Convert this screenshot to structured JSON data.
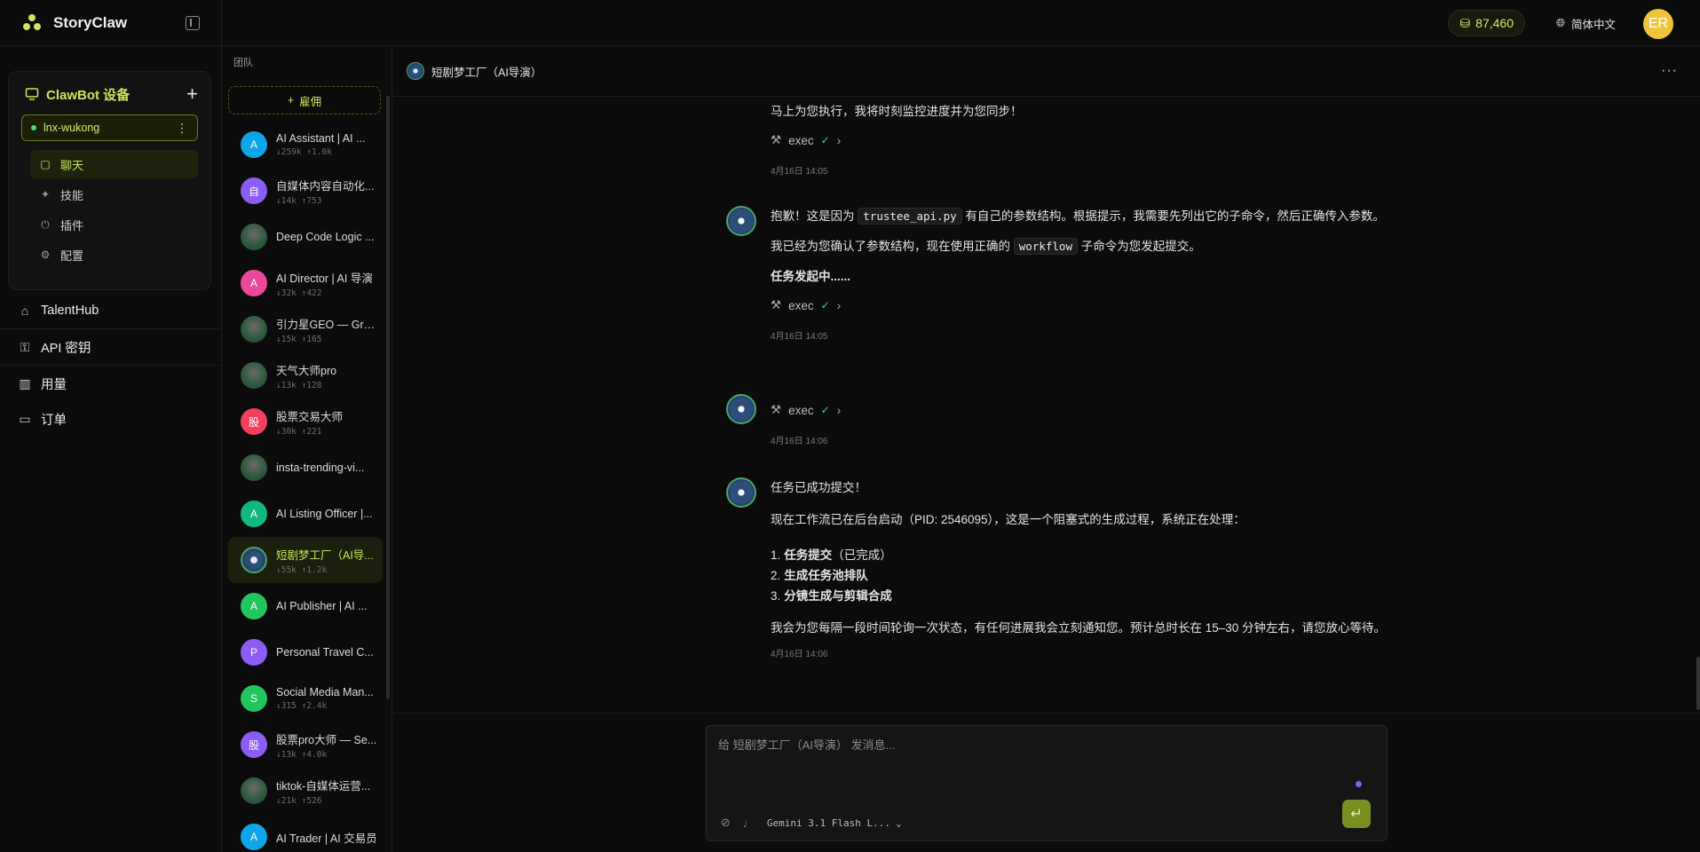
{
  "app": {
    "name": "StoryClaw"
  },
  "topbar": {
    "credits": "87,460",
    "language": "简体中文",
    "user_initials": "ER"
  },
  "device_card": {
    "title": "ClawBot 设备",
    "device_name": "lnx-wukong",
    "menu": [
      {
        "label": "聊天",
        "icon": "chat-icon",
        "active": true
      },
      {
        "label": "技能",
        "icon": "sparkle-icon",
        "active": false
      },
      {
        "label": "插件",
        "icon": "plug-icon",
        "active": false
      },
      {
        "label": "配置",
        "icon": "gear-icon",
        "active": false
      }
    ]
  },
  "nav": [
    {
      "label": "TalentHub",
      "icon": "robot-icon"
    },
    {
      "label": "API 密钥",
      "icon": "key-icon"
    },
    {
      "label": "用量",
      "icon": "bar-chart-icon"
    },
    {
      "label": "订单",
      "icon": "card-icon"
    }
  ],
  "agents_panel": {
    "title": "团队",
    "hire_label": "雇佣",
    "agents": [
      {
        "name": "AI Assistant | AI ...",
        "stats": "↓259k ↑1.0k",
        "avatar": "A",
        "color": "#0ea5e9",
        "type": "letter"
      },
      {
        "name": "自媒体内容自动化...",
        "stats": "↓14k ↑753",
        "avatar": "自",
        "color": "#8b5cf6",
        "type": "letter"
      },
      {
        "name": "Deep Code Logic ...",
        "stats": "",
        "avatar": "",
        "color": "",
        "type": "img"
      },
      {
        "name": "AI Director | AI 导演",
        "stats": "↓32k ↑422",
        "avatar": "A",
        "color": "#ec4899",
        "type": "letter"
      },
      {
        "name": "引力星GEO — Gra...",
        "stats": "↓15k ↑165",
        "avatar": "",
        "color": "",
        "type": "img"
      },
      {
        "name": "天气大师pro",
        "stats": "↓13k ↑128",
        "avatar": "",
        "color": "",
        "type": "img"
      },
      {
        "name": "股票交易大师",
        "stats": "↓30k ↑221",
        "avatar": "股",
        "color": "#f43f5e",
        "type": "letter"
      },
      {
        "name": "insta-trending-vi...",
        "stats": "",
        "avatar": "",
        "color": "",
        "type": "img"
      },
      {
        "name": "AI Listing Officer |...",
        "stats": "",
        "avatar": "A",
        "color": "#10b981",
        "type": "letter"
      },
      {
        "name": "短剧梦工厂（AI导...",
        "stats": "↓55k ↑1.2k",
        "avatar": "",
        "color": "",
        "type": "emblem",
        "active": true
      },
      {
        "name": "AI Publisher | AI ...",
        "stats": "",
        "avatar": "A",
        "color": "#22c55e",
        "type": "letter"
      },
      {
        "name": "Personal Travel C...",
        "stats": "",
        "avatar": "P",
        "color": "#8b5cf6",
        "type": "letter"
      },
      {
        "name": "Social Media Man...",
        "stats": "↓315 ↑2.4k",
        "avatar": "S",
        "color": "#22c55e",
        "type": "letter"
      },
      {
        "name": "股票pro大师 — Se...",
        "stats": "↓13k ↑4.0k",
        "avatar": "股",
        "color": "#8b5cf6",
        "type": "letter"
      },
      {
        "name": "tiktok-自媒体运营...",
        "stats": "↓21k ↑526",
        "avatar": "",
        "color": "",
        "type": "img"
      },
      {
        "name": "AI Trader | AI 交易员",
        "stats": "",
        "avatar": "A",
        "color": "#0ea5e9",
        "type": "letter"
      }
    ]
  },
  "chat": {
    "title": "短剧梦工厂（AI导演）",
    "msg0_text": "马上为您执行，我将时刻监控进度并为您同步！",
    "tool_label": "exec",
    "msg0_time": "4月16日 14:05",
    "msg1_p1_a": "抱歉！这是因为",
    "msg1_p1_code": "trustee_api.py",
    "msg1_p1_b": "有自己的参数结构。根据提示，我需要先列出它的子命令，然后正确传入参数。",
    "msg1_p2_a": "我已经为您确认了参数结构，现在使用正确的",
    "msg1_p2_code": "workflow",
    "msg1_p2_b": "子命令为您发起提交。",
    "msg1_p3": "任务发起中......",
    "msg1_time": "4月16日 14:05",
    "msg2_time": "4月16日 14:06",
    "msg3_p1": "任务已成功提交！",
    "msg3_p2": "现在工作流已在后台启动（PID: 2546095），这是一个阻塞式的生成过程，系统正在处理：",
    "msg3_list": [
      {
        "num": "1.",
        "bold": "任务提交",
        "rest": "（已完成）"
      },
      {
        "num": "2.",
        "bold": "生成任务池排队",
        "rest": ""
      },
      {
        "num": "3.",
        "bold": "分镜生成与剪辑合成",
        "rest": ""
      }
    ],
    "msg3_p3": "我会为您每隔一段时间轮询一次状态，有任何进展我会立刻通知您。预计总时长在 15–30 分钟左右，请您放心等待。",
    "msg3_time": "4月16日 14:06"
  },
  "composer": {
    "placeholder": "给 短剧梦工厂（AI导演） 发消息...",
    "model": "Gemini 3.1 Flash L..."
  }
}
